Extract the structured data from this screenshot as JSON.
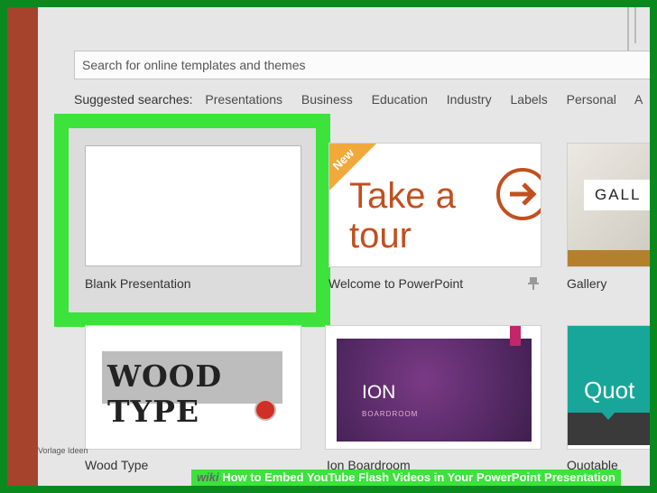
{
  "search": {
    "placeholder": "Search for online templates and themes"
  },
  "suggested": {
    "label": "Suggested searches:",
    "items": [
      "Presentations",
      "Business",
      "Education",
      "Industry",
      "Labels",
      "Personal",
      "A"
    ]
  },
  "templates": {
    "blank": {
      "caption": "Blank Presentation"
    },
    "tour": {
      "badge": "New",
      "title": "Take a tour",
      "caption": "Welcome to PowerPoint"
    },
    "gallery": {
      "thumb_text": "GALL",
      "caption": "Gallery"
    },
    "wood": {
      "thumb_text": "WOOD TYPE",
      "caption": "Wood Type"
    },
    "ion": {
      "thumb_title": "ION",
      "thumb_sub": "BOARDROOM",
      "caption": "Ion Boardroom"
    },
    "quotable": {
      "thumb_text": "Quot",
      "caption": "Quotable"
    }
  },
  "watermark": {
    "text": "Vorlage Ideen"
  },
  "footer": {
    "wiki": "wiki",
    "title": "How to Embed YouTube Flash Videos in Your PowerPoint Presentation"
  },
  "colors": {
    "accent_green": "#3be33b",
    "sidebar": "#a5432d",
    "tour_orange": "#c0501f"
  }
}
